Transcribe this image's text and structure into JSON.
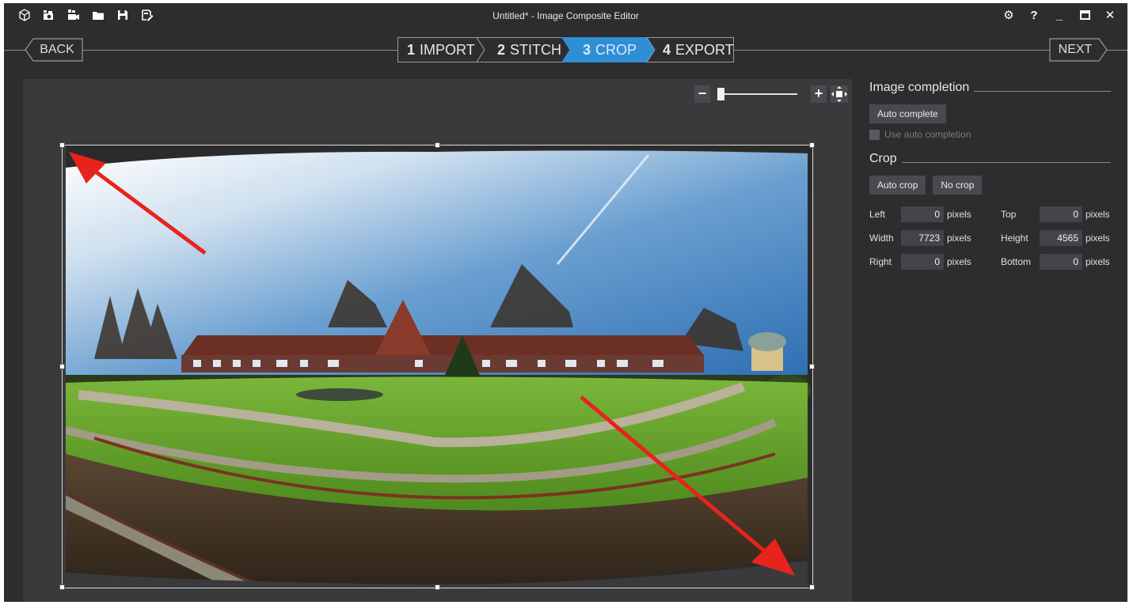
{
  "window": {
    "title": "Untitled* - Image Composite Editor",
    "toolbar_icons": [
      "new-project-icon",
      "new-panorama-from-images-icon",
      "new-panorama-from-video-icon",
      "open-project-icon",
      "save-project-icon",
      "save-as-icon"
    ],
    "controls": {
      "settings": "⚙",
      "help": "?",
      "minimize": "_",
      "maximize": "☐",
      "close": "✕"
    }
  },
  "nav": {
    "back_label": "BACK",
    "next_label": "NEXT",
    "steps": [
      {
        "num": "1",
        "label": "IMPORT",
        "active": false
      },
      {
        "num": "2",
        "label": "STITCH",
        "active": false
      },
      {
        "num": "3",
        "label": "CROP",
        "active": true
      },
      {
        "num": "4",
        "label": "EXPORT",
        "active": false
      }
    ],
    "active_color": "#2e8fd6"
  },
  "zoom": {
    "minus": "−",
    "plus": "+",
    "level": 0.0
  },
  "panel": {
    "image_completion": {
      "title": "Image completion",
      "auto_complete_label": "Auto complete",
      "use_auto_completion_label": "Use auto completion",
      "use_auto_completion_checked": false
    },
    "crop": {
      "title": "Crop",
      "auto_crop_label": "Auto crop",
      "no_crop_label": "No crop",
      "unit": "pixels",
      "fields": {
        "left": {
          "label": "Left",
          "value": "0"
        },
        "top": {
          "label": "Top",
          "value": "0"
        },
        "width": {
          "label": "Width",
          "value": "7723"
        },
        "height": {
          "label": "Height",
          "value": "4565"
        },
        "right": {
          "label": "Right",
          "value": "0"
        },
        "bottom": {
          "label": "Bottom",
          "value": "0"
        }
      }
    }
  },
  "annotation_color": "#e8231d"
}
